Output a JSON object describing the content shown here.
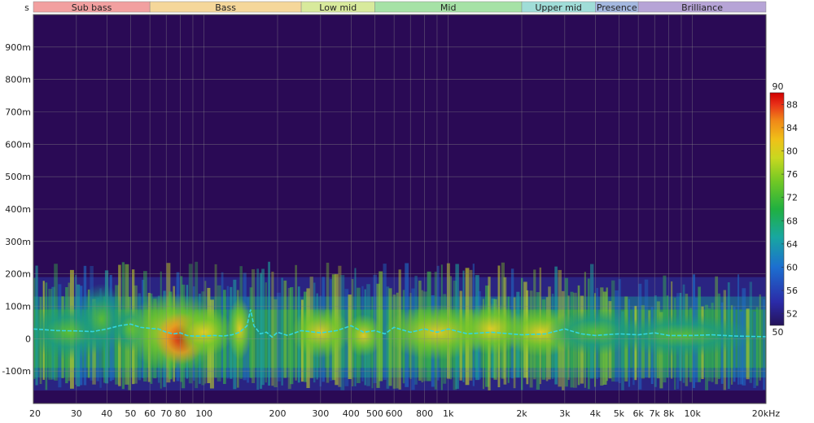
{
  "chart_data": {
    "type": "heatmap",
    "title": "",
    "x_axis": {
      "scale": "log",
      "range_hz": [
        20,
        20000
      ],
      "ticks": [
        {
          "v": 20,
          "label": "20"
        },
        {
          "v": 30,
          "label": "30"
        },
        {
          "v": 40,
          "label": "40"
        },
        {
          "v": 50,
          "label": "50"
        },
        {
          "v": 60,
          "label": "60"
        },
        {
          "v": 70,
          "label": "70"
        },
        {
          "v": 80,
          "label": "80"
        },
        {
          "v": 100,
          "label": "100"
        },
        {
          "v": 200,
          "label": "200"
        },
        {
          "v": 300,
          "label": "300"
        },
        {
          "v": 400,
          "label": "400"
        },
        {
          "v": 500,
          "label": "500"
        },
        {
          "v": 600,
          "label": "600"
        },
        {
          "v": 800,
          "label": "800"
        },
        {
          "v": 1000,
          "label": "1k"
        },
        {
          "v": 2000,
          "label": "2k"
        },
        {
          "v": 3000,
          "label": "3k"
        },
        {
          "v": 4000,
          "label": "4k"
        },
        {
          "v": 5000,
          "label": "5k"
        },
        {
          "v": 6000,
          "label": "6k"
        },
        {
          "v": 7000,
          "label": "7k"
        },
        {
          "v": 8000,
          "label": "8k"
        },
        {
          "v": 10000,
          "label": "10k"
        },
        {
          "v": 20000,
          "label": "20kHz"
        }
      ]
    },
    "y_axis": {
      "unit_label": "s",
      "range_ms": [
        -200,
        1000
      ],
      "ticks": [
        {
          "v": 900,
          "label": "900m"
        },
        {
          "v": 800,
          "label": "800m"
        },
        {
          "v": 700,
          "label": "700m"
        },
        {
          "v": 600,
          "label": "600m"
        },
        {
          "v": 500,
          "label": "500m"
        },
        {
          "v": 400,
          "label": "400m"
        },
        {
          "v": 300,
          "label": "300m"
        },
        {
          "v": 200,
          "label": "200m"
        },
        {
          "v": 100,
          "label": "100m"
        },
        {
          "v": 0,
          "label": "0"
        },
        {
          "v": -100,
          "label": "-100m"
        }
      ]
    },
    "bands": [
      {
        "name": "Sub bass",
        "from": 20,
        "to": 60,
        "color": "#f2a0a0"
      },
      {
        "name": "Bass",
        "from": 60,
        "to": 250,
        "color": "#f5d79a"
      },
      {
        "name": "Low mid",
        "from": 250,
        "to": 500,
        "color": "#d8ea9c"
      },
      {
        "name": "Mid",
        "from": 500,
        "to": 2000,
        "color": "#a6e2a6"
      },
      {
        "name": "Upper mid",
        "from": 2000,
        "to": 4000,
        "color": "#a0ddd8"
      },
      {
        "name": "Presence",
        "from": 4000,
        "to": 6000,
        "color": "#a4b8e0"
      },
      {
        "name": "Brilliance",
        "from": 6000,
        "to": 20000,
        "color": "#b6a4d6"
      }
    ],
    "color_scale": {
      "min": 50,
      "max": 90,
      "ticks": [
        {
          "v": 90,
          "label": "90"
        },
        {
          "v": 88,
          "label": "88"
        },
        {
          "v": 84,
          "label": "84"
        },
        {
          "v": 80,
          "label": "80"
        },
        {
          "v": 76,
          "label": "76"
        },
        {
          "v": 72,
          "label": "72"
        },
        {
          "v": 68,
          "label": "68"
        },
        {
          "v": 64,
          "label": "64"
        },
        {
          "v": 60,
          "label": "60"
        },
        {
          "v": 56,
          "label": "56"
        },
        {
          "v": 52,
          "label": "52"
        },
        {
          "v": 50,
          "label": "50"
        }
      ]
    },
    "background_color": "#2a0a55",
    "peak_time_series": {
      "color": "#33d6e0",
      "points": [
        [
          20,
          30
        ],
        [
          25,
          25
        ],
        [
          30,
          24
        ],
        [
          35,
          22
        ],
        [
          40,
          30
        ],
        [
          45,
          40
        ],
        [
          50,
          45
        ],
        [
          55,
          35
        ],
        [
          60,
          32
        ],
        [
          65,
          30
        ],
        [
          70,
          20
        ],
        [
          75,
          15
        ],
        [
          80,
          18
        ],
        [
          85,
          10
        ],
        [
          90,
          8
        ],
        [
          100,
          8
        ],
        [
          110,
          10
        ],
        [
          120,
          8
        ],
        [
          130,
          12
        ],
        [
          140,
          20
        ],
        [
          150,
          40
        ],
        [
          155,
          90
        ],
        [
          160,
          40
        ],
        [
          170,
          15
        ],
        [
          180,
          20
        ],
        [
          190,
          5
        ],
        [
          200,
          20
        ],
        [
          220,
          10
        ],
        [
          250,
          25
        ],
        [
          300,
          18
        ],
        [
          350,
          25
        ],
        [
          400,
          40
        ],
        [
          450,
          20
        ],
        [
          500,
          25
        ],
        [
          550,
          15
        ],
        [
          600,
          35
        ],
        [
          700,
          20
        ],
        [
          800,
          30
        ],
        [
          900,
          20
        ],
        [
          1000,
          30
        ],
        [
          1200,
          15
        ],
        [
          1500,
          20
        ],
        [
          2000,
          12
        ],
        [
          2500,
          15
        ],
        [
          3000,
          30
        ],
        [
          3500,
          15
        ],
        [
          4000,
          10
        ],
        [
          5000,
          15
        ],
        [
          6000,
          12
        ],
        [
          7000,
          18
        ],
        [
          8000,
          10
        ],
        [
          10000,
          10
        ],
        [
          12000,
          12
        ],
        [
          15000,
          8
        ],
        [
          20000,
          6
        ]
      ]
    }
  }
}
